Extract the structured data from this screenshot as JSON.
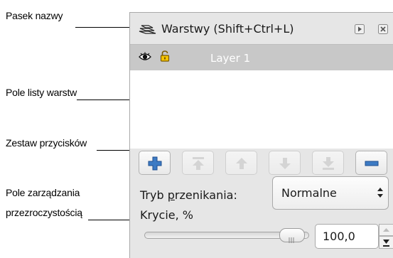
{
  "annotations": {
    "title_bar": "Pasek nazwy",
    "layer_list": "Pole listy warstw",
    "button_set": "Zestaw przycisków",
    "opacity_line1": "Pole zarządzania",
    "opacity_line2": "przezroczystością"
  },
  "dialog": {
    "title": "Warstwy (Shift+Ctrl+L)",
    "icons": [
      "layers-icon",
      "dock-arrow-icon",
      "close-icon"
    ]
  },
  "layers": {
    "items": [
      {
        "name": "Layer 1",
        "visible": true,
        "locked": false
      }
    ]
  },
  "buttons": [
    {
      "name": "add-layer-button",
      "icon": "plus-icon",
      "enabled": true
    },
    {
      "name": "raise-to-top-button",
      "icon": "raise-top-icon",
      "enabled": false
    },
    {
      "name": "raise-layer-button",
      "icon": "arrow-up-icon",
      "enabled": false
    },
    {
      "name": "lower-layer-button",
      "icon": "arrow-down-icon",
      "enabled": false
    },
    {
      "name": "lower-to-bottom-button",
      "icon": "lower-bottom-icon",
      "enabled": false
    },
    {
      "name": "remove-layer-button",
      "icon": "minus-icon",
      "enabled": true
    }
  ],
  "blend": {
    "label_pre": "Tryb ",
    "label_mnemonic": "p",
    "label_post": "rzenikania:",
    "selected": "Normalne"
  },
  "opacity": {
    "label": "Krycie, %",
    "value": "100,0",
    "level": 100
  },
  "colors": {
    "panel_bg": "#e6e6e6",
    "selected_row": "#c8c8c8",
    "plus_blue": "#3d7bc4"
  }
}
